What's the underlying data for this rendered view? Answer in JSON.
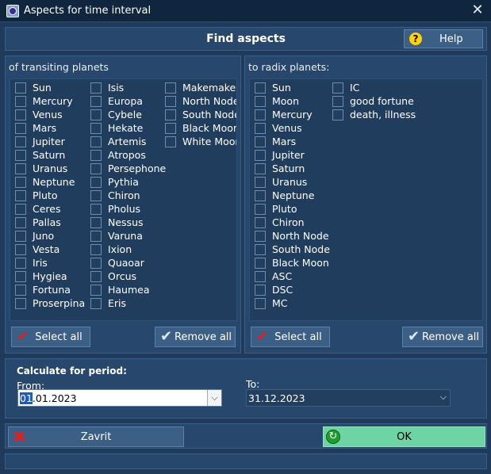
{
  "window": {
    "title": "Aspects for time interval",
    "close_glyph": "✕"
  },
  "header": {
    "title": "Find aspects",
    "help_label": "Help",
    "help_glyph": "?"
  },
  "transiting": {
    "title": "of transiting planets",
    "columns": [
      [
        "Sun",
        "Mercury",
        "Venus",
        "Mars",
        "Jupiter",
        "Saturn",
        "Uranus",
        "Neptune",
        "Pluto",
        "Ceres",
        "Pallas",
        "Juno",
        "Vesta",
        "Iris",
        "Hygiea",
        "Fortuna",
        "Proserpina"
      ],
      [
        "Isis",
        "Europa",
        "Cybele",
        "Hekate",
        "Artemis",
        "Atropos",
        "Persephone",
        "Pythia",
        "Chiron",
        "Pholus",
        "Nessus",
        "Varuna",
        "Ixion",
        "Quaoar",
        "Orcus",
        "Haumea",
        "Eris"
      ],
      [
        "Makemake",
        "North Node",
        "South Node",
        "Black Moon",
        "White Moon"
      ]
    ],
    "select_all": "Select all",
    "remove_all": "Remove all"
  },
  "radix": {
    "title": "to radix planets:",
    "columns": [
      [
        "Sun",
        "Moon",
        "Mercury",
        "Venus",
        "Mars",
        "Jupiter",
        "Saturn",
        "Uranus",
        "Neptune",
        "Pluto",
        "Chiron",
        "North Node",
        "South Node",
        "Black Moon",
        "ASC",
        "DSC",
        "MC"
      ],
      [
        "IC",
        "good fortune",
        "death, illness"
      ]
    ],
    "select_all": "Select all",
    "remove_all": "Remove all"
  },
  "period": {
    "title": "Calculate for period:",
    "from_label": "From:",
    "from_selected": "01",
    "from_rest": ".01.2023",
    "to_label": "To:",
    "to_value": "31.12.2023",
    "dropdown_glyph": "⌵"
  },
  "footer": {
    "close_label": "Zavrit",
    "ok_label": "OK",
    "close_glyph": "✖",
    "ok_glyph": "↻"
  },
  "icons": {
    "check_glyph": "✔"
  },
  "colors": {
    "background": "#1f3a5a",
    "panel": "#27486c",
    "ok_button": "#6fd4a4",
    "red": "#e41c1c"
  }
}
